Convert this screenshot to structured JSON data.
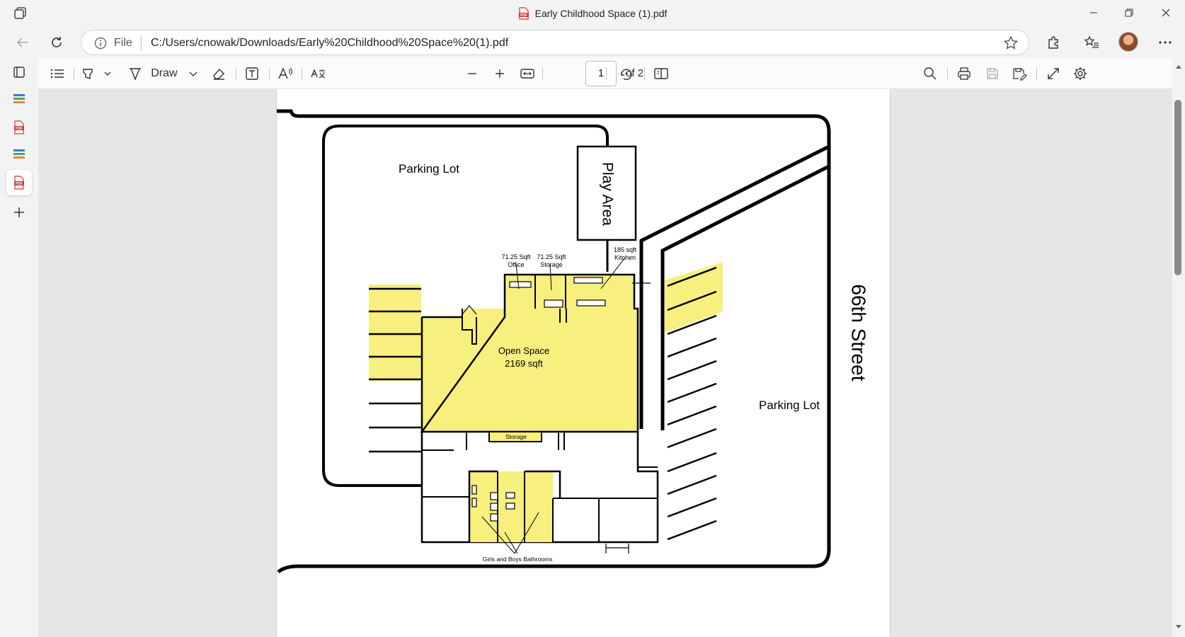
{
  "window": {
    "title": "Early Childhood Space (1).pdf"
  },
  "address_bar": {
    "scheme_label": "File",
    "url": "C:/Users/cnowak/Downloads/Early%20Childhood%20Space%20(1).pdf"
  },
  "toolbar": {
    "draw_label": "Draw",
    "page_current": "1",
    "page_total_label": "of 2"
  },
  "floorplan": {
    "parking_lot_north": "Parking Lot",
    "parking_lot_east": "Parking Lot",
    "play_area": "Play Area",
    "street": "66th Street",
    "office_area": "71.25 Sqft",
    "office_label": "Office",
    "storage_area": "71.25 Sqft",
    "storage_label": "Storage",
    "kitchen_area": "185 sqft",
    "kitchen_label": "Kitchen",
    "open_space_label": "Open Space",
    "open_space_area": "2169 sqft",
    "small_storage_label": "Storage",
    "bathrooms_label": "Girls and Boys Bathrooms"
  },
  "colors": {
    "highlight_yellow": "#f7ef7e",
    "accent_pdf_red": "#d13438"
  }
}
